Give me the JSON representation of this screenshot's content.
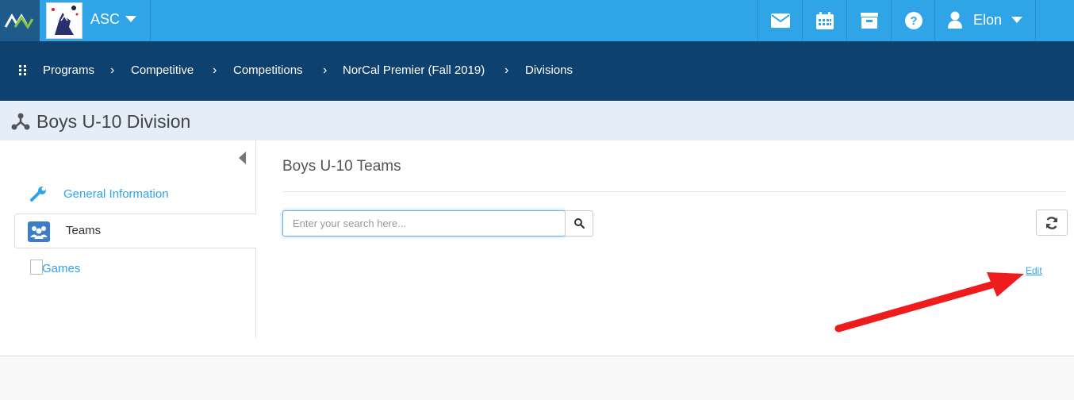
{
  "header": {
    "org_name": "ASC",
    "user_name": "Elon",
    "icons": [
      "mail-icon",
      "calendar-icon",
      "archive-icon",
      "help-icon",
      "user-icon"
    ]
  },
  "breadcrumb": {
    "items": [
      "Programs",
      "Competitive",
      "Competitions",
      "NorCal Premier (Fall 2019)",
      "Divisions"
    ]
  },
  "page": {
    "title": "Boys U-10 Division"
  },
  "sidebar": {
    "items": [
      {
        "label": "General Information",
        "icon": "wrench-icon"
      },
      {
        "label": "Teams",
        "icon": "teams-icon",
        "active": true
      },
      {
        "label": "Games",
        "icon": "image-placeholder-icon"
      }
    ]
  },
  "main": {
    "section_title": "Boys U-10 Teams",
    "search_placeholder": "Enter your search here...",
    "edit_label": "Edit"
  },
  "colors": {
    "topbar": "#2fa4e7",
    "breadcrumb_bar": "#0f416f",
    "title_bar": "#e3eef8",
    "accent": "#2fa4e7",
    "annotation_arrow": "#ee1c1c"
  }
}
